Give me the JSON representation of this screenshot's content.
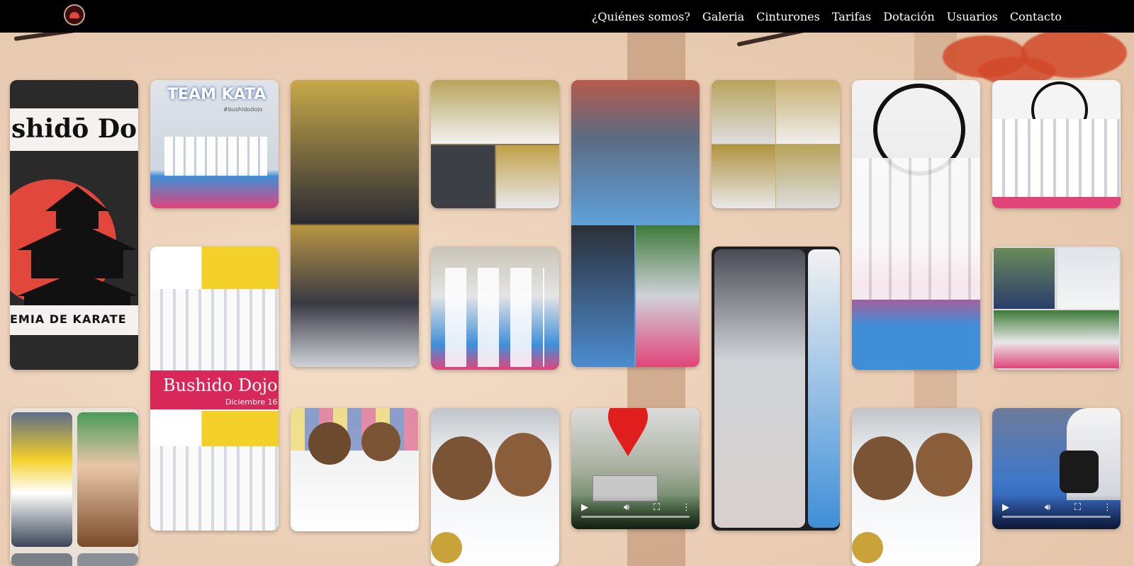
{
  "nav": {
    "logo": "bushido-dojo-logo",
    "links": [
      "¿Quiénes somos?",
      "Galeria",
      "Cinturones",
      "Tarifas",
      "Dotación",
      "Usuarios",
      "Contacto"
    ]
  },
  "gallery": {
    "logo_card_text_top": "shidō Do",
    "logo_card_text_bottom": "EMIA DE KARATE",
    "team_kata_title": "TEAM KATA",
    "team_kata_tag": "#bushidodojo",
    "event_title": "Bushido Dojo",
    "event_date": "Diciembre 16"
  },
  "colors": {
    "nav_bg": "#000000",
    "accent_red": "#e2473b",
    "mat_blue": "#3f8fd8",
    "mat_pink": "#e0457a"
  }
}
